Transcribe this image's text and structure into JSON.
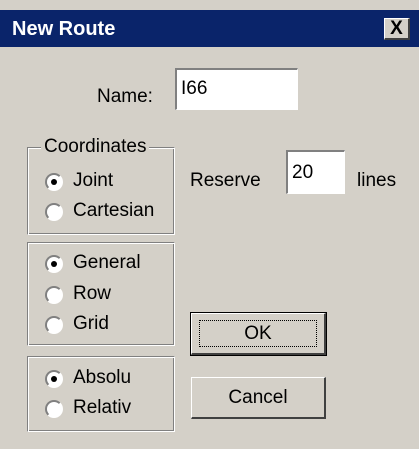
{
  "window": {
    "title": "New Route",
    "close_label": "X"
  },
  "name": {
    "label": "Name:",
    "value": "I66"
  },
  "coordinates": {
    "legend": "Coordinates",
    "options": [
      "Joint",
      "Cartesian"
    ],
    "selected": "Joint"
  },
  "reserve": {
    "label": "Reserve",
    "value": "20",
    "unit": "lines"
  },
  "motion_type": {
    "options": [
      "General",
      "Row",
      "Grid"
    ],
    "selected": "General"
  },
  "position_mode": {
    "options": [
      "Absolu",
      "Relativ"
    ],
    "selected": "Absolu"
  },
  "buttons": {
    "ok": "OK",
    "cancel": "Cancel"
  }
}
